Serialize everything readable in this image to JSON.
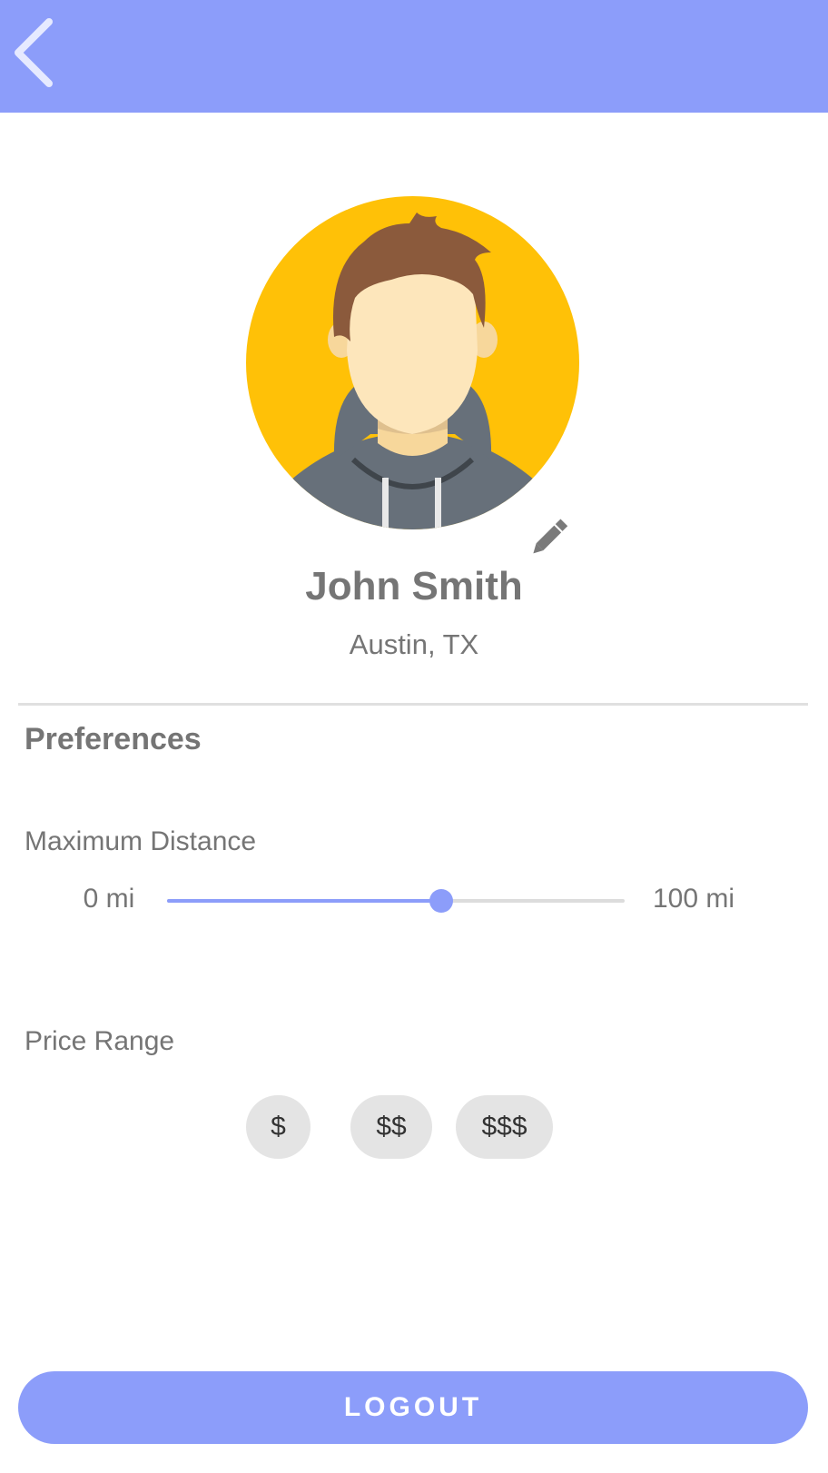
{
  "colors": {
    "primary": "#8c9dfa",
    "avatar_background": "#ffc107",
    "text": "#757575",
    "chip_background": "#e4e4e4"
  },
  "header": {
    "back_icon": "chevron-left-icon"
  },
  "profile": {
    "name": "John Smith",
    "location": "Austin, TX",
    "avatar_icon": "user-avatar",
    "edit_icon": "pencil-icon"
  },
  "preferences": {
    "title": "Preferences",
    "max_distance": {
      "label": "Maximum Distance",
      "min_label": "0 mi",
      "max_label": "100 mi",
      "min": 0,
      "max": 100,
      "value": 60
    },
    "price_range": {
      "label": "Price Range",
      "options": [
        "$",
        "$$",
        "$$$"
      ]
    }
  },
  "logout": {
    "label": "LOGOUT"
  }
}
